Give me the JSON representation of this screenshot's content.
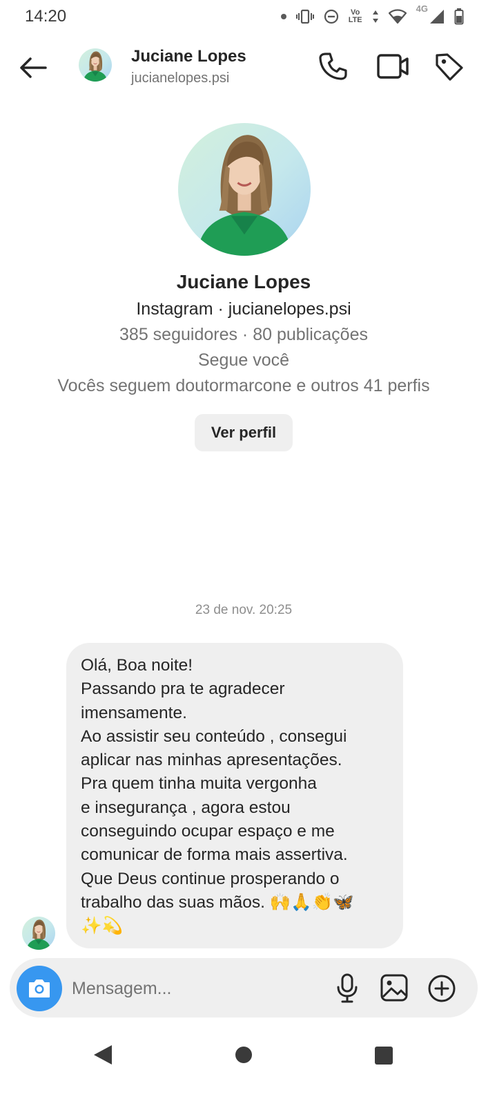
{
  "status_bar": {
    "time": "14:20",
    "volte_top": "Vo",
    "volte_bottom": "LTE",
    "network": "4G",
    "icons": [
      "notification-dot-icon",
      "vibrate-icon",
      "do-not-disturb-icon",
      "volte-icon",
      "data-arrows-icon",
      "wifi-icon",
      "signal-icon",
      "battery-icon"
    ]
  },
  "header": {
    "name": "Juciane Lopes",
    "username": "jucianelopes.psi",
    "actions": [
      "phone-icon",
      "video-camera-icon",
      "tag-icon"
    ]
  },
  "profile": {
    "name": "Juciane Lopes",
    "source": "Instagram · jucianelopes.psi",
    "stats": "385 seguidores · 80 publicações",
    "follow_status": "Segue você",
    "mutual": "Vocês seguem doutormarcone e outros 41 perfis",
    "view_profile_label": "Ver perfil"
  },
  "conversation": {
    "timestamp": "23 de nov. 20:25",
    "message": "Olá,  Boa noite!\nPassando pra te agradecer imensamente.\nAo assistir  seu conteúdo , consegui aplicar nas minhas apresentações.\nPra quem tinha muita vergonha\ne insegurança , agora estou conseguindo  ocupar espaço e me comunicar de forma mais assertiva.\nQue Deus continue  prosperando o trabalho  das suas mãos. 🙌🙏👏🦋\n✨💫"
  },
  "composer": {
    "placeholder": "Mensagem...",
    "icons": [
      "camera-icon",
      "microphone-icon",
      "image-icon",
      "add-circle-icon"
    ]
  },
  "nav_bar": {
    "icons": [
      "nav-back-icon",
      "nav-home-icon",
      "nav-recents-icon"
    ]
  },
  "colors": {
    "accent": "#3797f0",
    "bubble": "#efefef",
    "secondary_text": "#737373",
    "avatar_green": "#1f9d55"
  }
}
